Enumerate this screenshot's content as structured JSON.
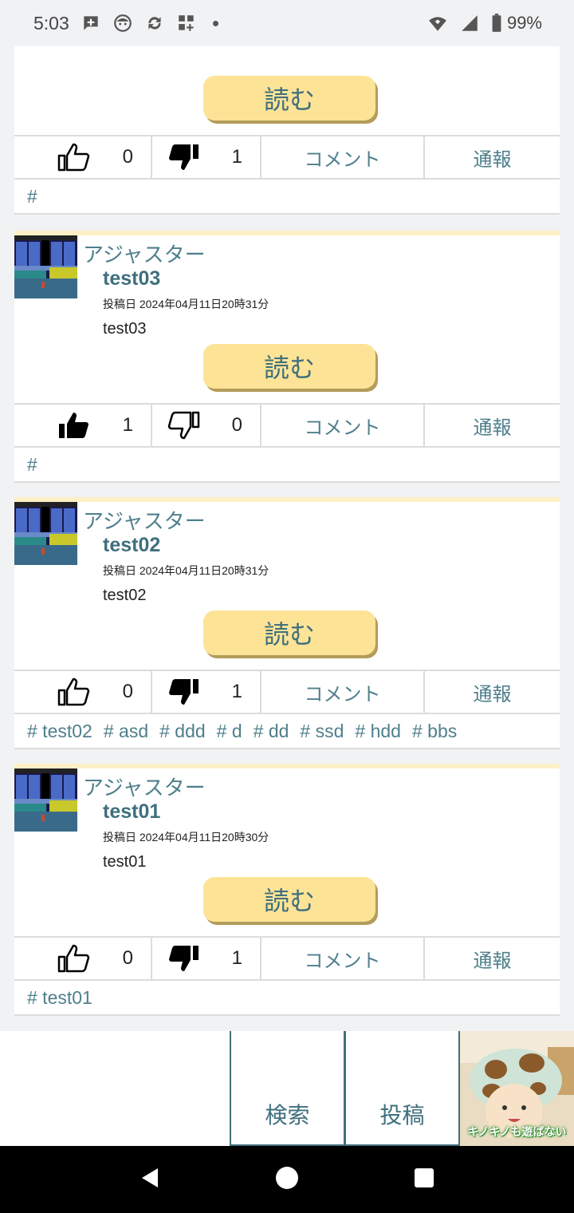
{
  "status_bar": {
    "time": "5:03",
    "battery": "99%",
    "icons": [
      "chat-plus-icon",
      "face-icon",
      "sync-icon",
      "widgets-icon",
      "dot-icon",
      "wifi-icon",
      "signal-icon",
      "battery-icon"
    ]
  },
  "colors": {
    "accent": "#3f6f7e",
    "read_button": "#fde396",
    "card_top": "#fdf0c6"
  },
  "top_card": {
    "read_label": "読む",
    "likes": "0",
    "dislikes": "1",
    "liked": false,
    "disliked": true,
    "comment_label": "コメント",
    "report_label": "通報",
    "tags": [
      "#"
    ]
  },
  "posts": [
    {
      "author": "アジャスター",
      "title": "test03",
      "date": "投稿日 2024年04月11日20時31分",
      "body": "test03",
      "read_label": "読む",
      "likes": "1",
      "dislikes": "0",
      "liked": true,
      "disliked": false,
      "comment_label": "コメント",
      "report_label": "通報",
      "tags": [
        "#"
      ]
    },
    {
      "author": "アジャスター",
      "title": "test02",
      "date": "投稿日 2024年04月11日20時31分",
      "body": "test02",
      "read_label": "読む",
      "likes": "0",
      "dislikes": "1",
      "liked": false,
      "disliked": true,
      "comment_label": "コメント",
      "report_label": "通報",
      "tags": [
        "# test02",
        "# asd",
        "# ddd",
        "# d",
        "# dd",
        "# ssd",
        "# hdd",
        "# bbs"
      ]
    },
    {
      "author": "アジャスター",
      "title": "test01",
      "date": "投稿日 2024年04月11日20時30分",
      "body": "test01",
      "read_label": "読む",
      "likes": "0",
      "dislikes": "1",
      "liked": false,
      "disliked": true,
      "comment_label": "コメント",
      "report_label": "通報",
      "tags": [
        "# test01"
      ]
    }
  ],
  "bottom_nav": {
    "search_label": "検索",
    "post_label": "投稿",
    "ad_caption": "キノキノも遊ばない"
  }
}
